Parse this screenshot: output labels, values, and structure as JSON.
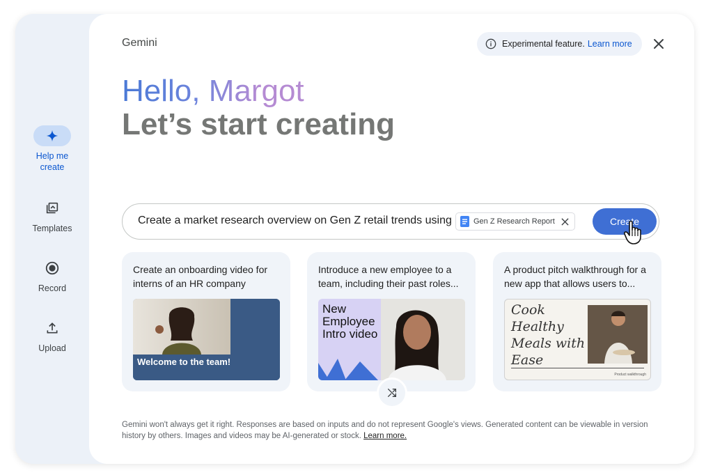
{
  "app": {
    "brand": "Gemini"
  },
  "experimental": {
    "text": "Experimental feature.",
    "link": "Learn more"
  },
  "sidebar": {
    "items": [
      {
        "label": "Help me create",
        "icon": "sparkle-icon",
        "active": true
      },
      {
        "label": "Templates",
        "icon": "templates-icon",
        "active": false
      },
      {
        "label": "Record",
        "icon": "record-icon",
        "active": false
      },
      {
        "label": "Upload",
        "icon": "upload-icon",
        "active": false
      }
    ]
  },
  "greeting": {
    "hello": "Hello, Margot",
    "subtitle": "Let’s start creating"
  },
  "prompt": {
    "text": "Create a market research overview on Gen Z retail trends using",
    "attachment": "Gen Z Research Report",
    "create_label": "Create"
  },
  "cards": [
    {
      "description": "Create an onboarding video for interns of an HR company",
      "thumb_caption": "Welcome to the team!"
    },
    {
      "description": "Introduce a new employee to a team, including their past roles...",
      "thumb_caption": "New Employee Intro video"
    },
    {
      "description": "A product pitch walkthrough for a new app that allows users to...",
      "thumb_caption": "Cook Healthy Meals with Ease",
      "thumb_footer": "Product walkthrough"
    }
  ],
  "disclaimer": {
    "text": "Gemini won't always get it right. Responses are based on inputs and do not represent Google's views. Generated content can be viewable in version history by others. Images and videos may be AI-generated or stock.",
    "link": "Learn more."
  },
  "colors": {
    "accent": "#3f6fd4",
    "link": "#0b57d0",
    "rail": "#ecf1f8",
    "card": "#f0f4f9"
  }
}
